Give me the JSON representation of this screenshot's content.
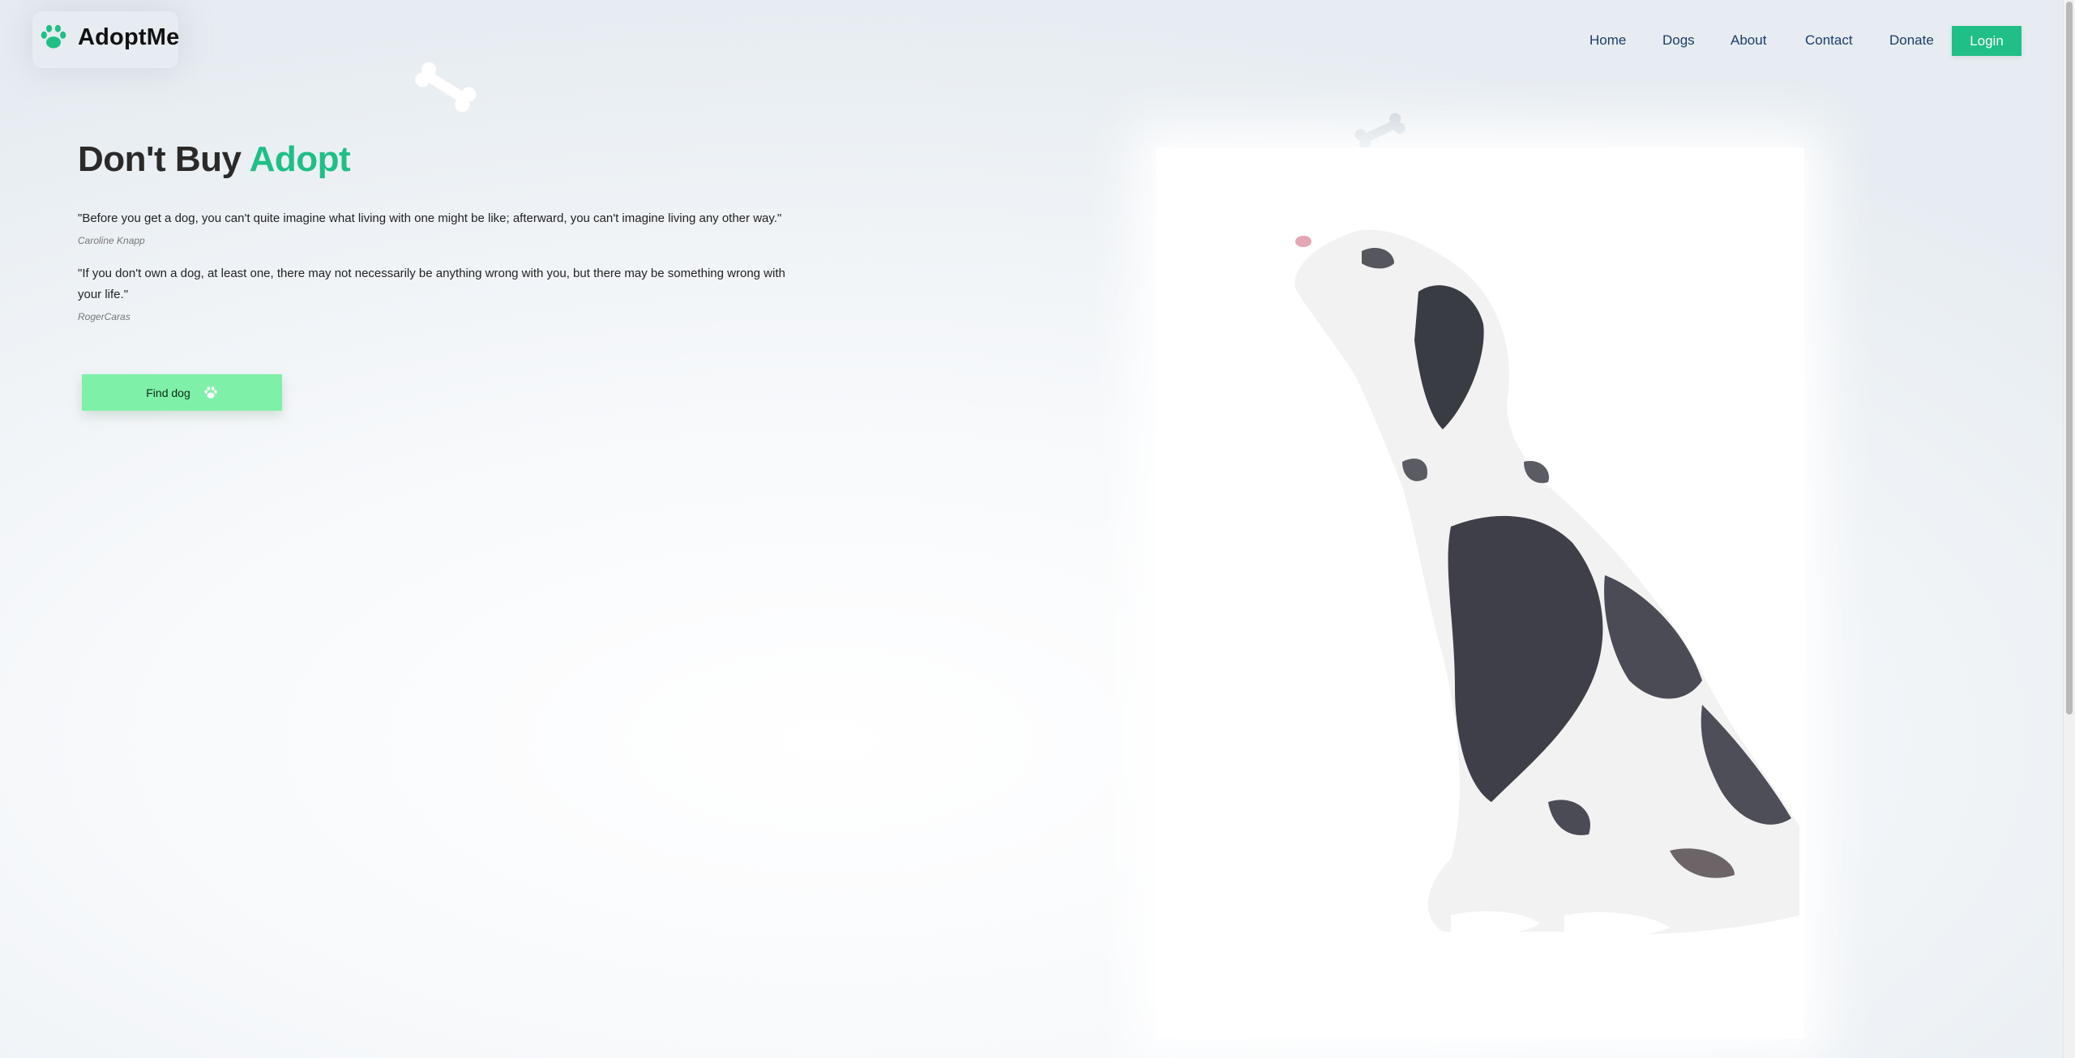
{
  "brand": {
    "name": "AdoptMe",
    "icon": "paw-icon",
    "accent_color": "#1fbf87"
  },
  "nav": {
    "items": [
      "Home",
      "Dogs",
      "About",
      "Contact",
      "Donate"
    ],
    "login_label": "Login"
  },
  "hero": {
    "title_part1": "Don't Buy",
    "title_part2": "Adopt",
    "quotes": [
      {
        "text": "\"Before you get a dog, you can't quite imagine what living with one might be like; afterward, you can't imagine living any other way.\"",
        "author": "Caroline Knapp"
      },
      {
        "text": "\"If you don't own a dog, at least one, there may not necessarily be anything wrong with you, but there may be something wrong with your life.\"",
        "author": "RogerCaras"
      }
    ],
    "cta_label": "Find dog",
    "cta_icon": "paw-icon",
    "cta_color": "#7ef0a8"
  },
  "image": {
    "subject": "great-dane-dog"
  }
}
